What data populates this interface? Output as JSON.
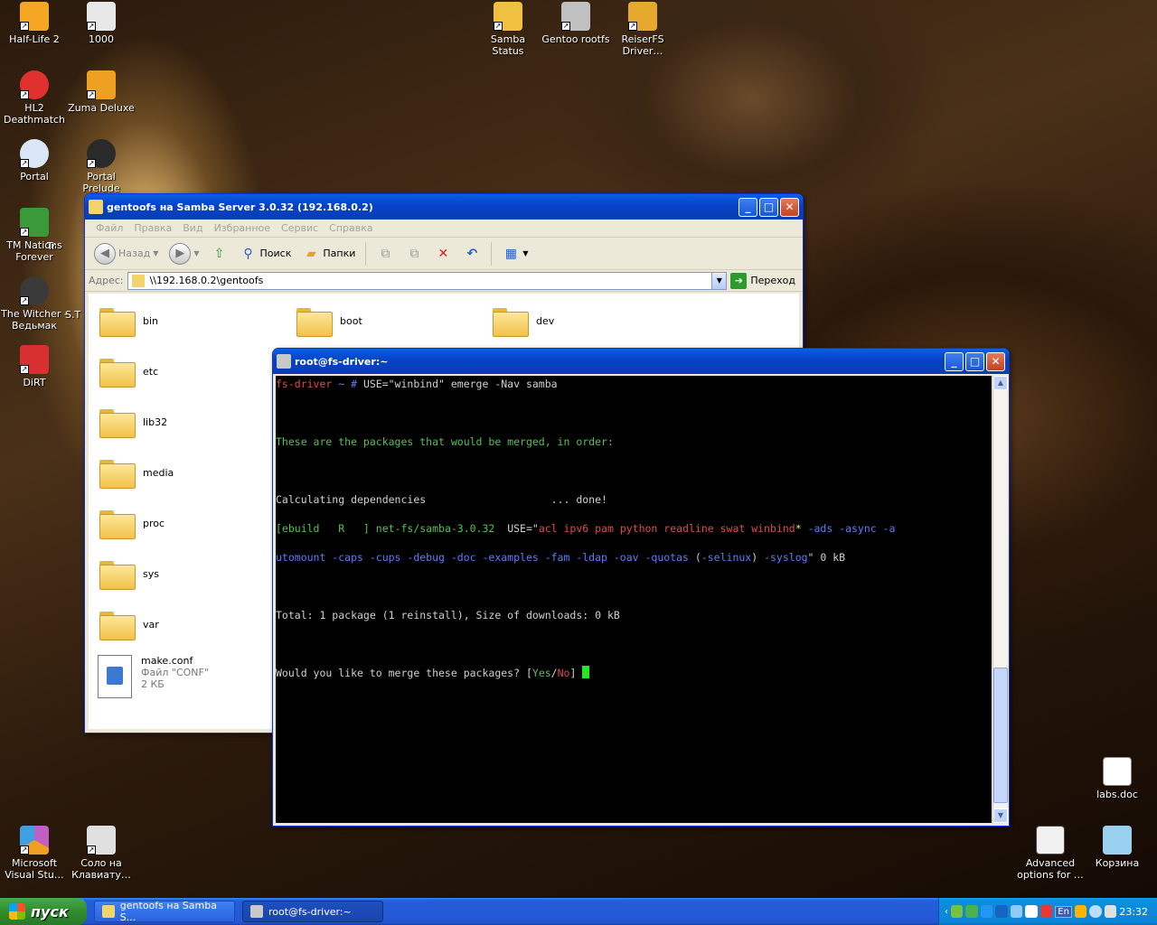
{
  "desktop": {
    "icons": [
      {
        "id": "hl2",
        "label": "Half-Life 2",
        "color": "#f5a623"
      },
      {
        "id": "g1000",
        "label": "1000",
        "color": "#e8e8e8"
      },
      {
        "id": "samba",
        "label": "Samba Status",
        "color": "#f0c040"
      },
      {
        "id": "gentoo",
        "label": "Gentoo rootfs",
        "color": "#c0c0c0"
      },
      {
        "id": "reiser",
        "label": "ReiserFS Driver…",
        "color": "#e6a92e"
      },
      {
        "id": "hl2dm",
        "label": "HL2 Deathmatch",
        "color": "#e03030"
      },
      {
        "id": "zuma",
        "label": "Zuma Deluxe",
        "color": "#f0a020"
      },
      {
        "id": "portal",
        "label": "Portal",
        "color": "#d8e6f6"
      },
      {
        "id": "portalprelude",
        "label": "Portal Prelude",
        "color": "#2a2a2a"
      },
      {
        "id": "tmnations",
        "label": "TM Nations Forever",
        "color": "#3a9a3a"
      },
      {
        "id": "tm2",
        "label": "Tr",
        "color": "#777777"
      },
      {
        "id": "witcher",
        "label": "The Witcher - Ведьмак",
        "color": "#3a3a3a"
      },
      {
        "id": "st",
        "label": "S.T",
        "color": "#555555"
      },
      {
        "id": "dirt",
        "label": "DiRT",
        "color": "#d83030"
      },
      {
        "id": "labs",
        "label": "labs.doc",
        "color": "#ffffff"
      },
      {
        "id": "msvs",
        "label": "Microsoft Visual Stu…",
        "color": "#c060c0"
      },
      {
        "id": "solo",
        "label": "Соло на Клавиату…",
        "color": "#e0e0e0"
      },
      {
        "id": "advopt",
        "label": "Advanced options for …",
        "color": "#f0f0f0"
      },
      {
        "id": "recycle",
        "label": "Корзина",
        "color": "#9ad0f0"
      }
    ]
  },
  "explorer": {
    "title": "gentoofs на Samba Server 3.0.32 (192.168.0.2)",
    "menu": [
      "Файл",
      "Правка",
      "Вид",
      "Избранное",
      "Сервис",
      "Справка"
    ],
    "toolbar": {
      "back": "Назад",
      "search": "Поиск",
      "folders": "Папки"
    },
    "address_label": "Адрес:",
    "address": "\\\\192.168.0.2\\gentoofs",
    "go": "Переход",
    "folders": [
      "bin",
      "boot",
      "dev",
      "etc",
      "lib32",
      "media",
      "proc",
      "sys",
      "var"
    ],
    "file": {
      "name": "make.conf",
      "type": "Файл \"CONF\"",
      "size": "2 КБ"
    }
  },
  "terminal": {
    "title": "root@fs-driver:~",
    "lines": {
      "prompt_host": "fs-driver",
      "prompt_rest": " ~ # ",
      "command": "USE=\"winbind\" emerge -Nav samba",
      "merge_msg": "These are the packages that would be merged, in order:",
      "calc": "Calculating dependencies                    ... done!",
      "ebuild_tag": "[ebuild   R   ] ",
      "pkg": "net-fs/samba-3.0.32",
      "use_pre": "  USE=\"",
      "use_on": "acl ipv6 pam python readline swat winbind",
      "use_star": "* ",
      "use_off1": "-ads -async -a",
      "use_off2": "utomount -caps -cups -debug -doc -examples -fam -ldap -oav -quotas",
      "selinux_open": " (",
      "selinux": "-selinux",
      "selinux_close": ") ",
      "syslog": "-syslog",
      "tail": "\" 0 kB",
      "total": "Total: 1 package (1 reinstall), Size of downloads: 0 kB",
      "question": "Would you like to merge these packages? ",
      "yes": "Yes",
      "slash": "/",
      "no": "No"
    }
  },
  "taskbar": {
    "start": "пуск",
    "tasks": [
      "gentoofs на Samba S...",
      "root@fs-driver:~"
    ],
    "lang": "En",
    "clock": "23:32"
  }
}
